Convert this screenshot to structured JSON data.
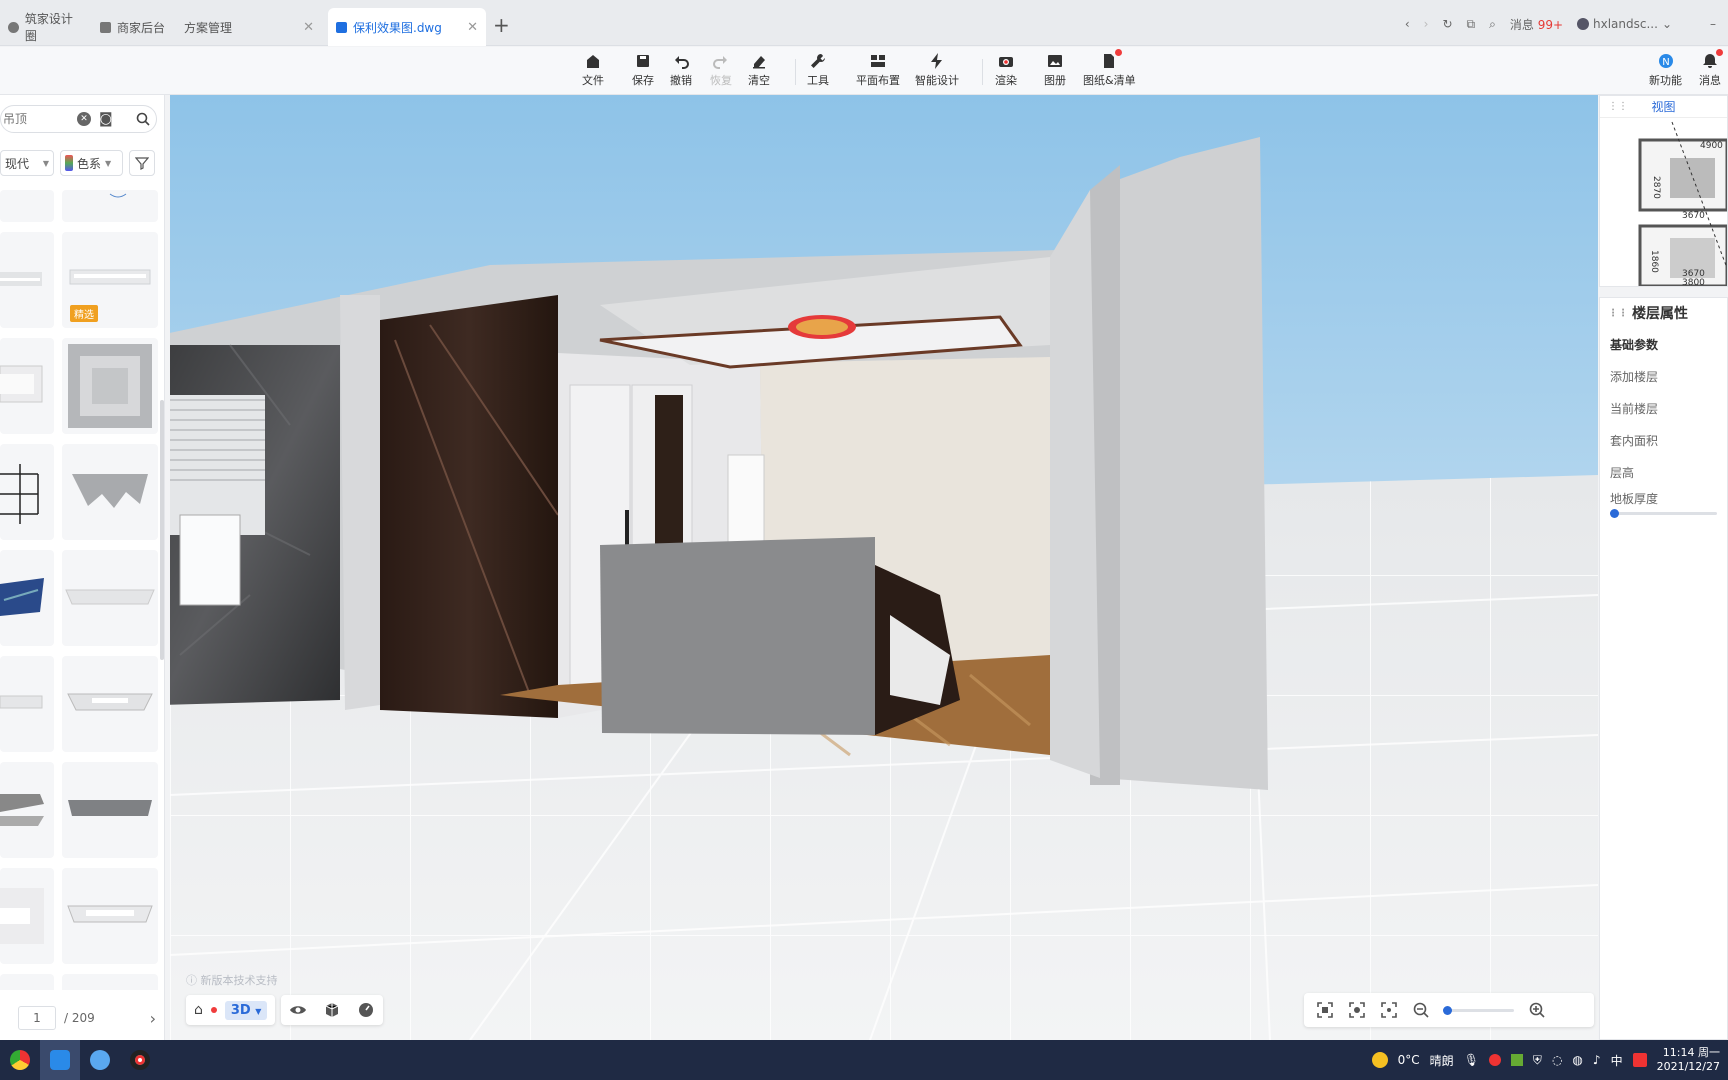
{
  "tabs": [
    {
      "label": "筑家设计圈"
    },
    {
      "label": "商家后台"
    },
    {
      "label": "方案管理"
    },
    {
      "label": "保利效果图.dwg"
    }
  ],
  "nav": {
    "message_label": "消息",
    "message_count": "99+",
    "user": "hxlandsc..."
  },
  "toolbar": {
    "file": "文件",
    "save": "保存",
    "undo": "撤销",
    "redo": "恢复",
    "clear": "清空",
    "tools": "工具",
    "floor_layout": "平面布置",
    "smart_design": "智能设计",
    "render": "渲染",
    "album": "图册",
    "drawings": "图纸&清单",
    "new_feature": "新功能",
    "messages": "消息"
  },
  "left": {
    "search_placeholder": "吊顶",
    "style_filter": "现代",
    "color_filter": "色系",
    "featured_badge": "精选",
    "page_current": "1",
    "page_total": "/ 209"
  },
  "viewport": {
    "mode": "3D",
    "watermark": "新版本技术支持"
  },
  "minimap": {
    "title": "视图",
    "dims": [
      "4900",
      "2870",
      "3670",
      "1860",
      "3670",
      "3800"
    ]
  },
  "floor_props": {
    "title": "楼层属性",
    "section": "基础参数",
    "rows": [
      "添加楼层",
      "当前楼层",
      "套内面积",
      "层高",
      "地板厚度"
    ],
    "slab_thickness_level": 0.02
  },
  "zoom": {
    "level": 0.02
  },
  "taskbar": {
    "weather_temp": "0°C",
    "weather_text": "晴朗",
    "time": "11:14 周一",
    "date": "2021/12/27",
    "ime": "中"
  },
  "colors": {
    "accent": "#2a6ad8",
    "alert": "#f03c3c",
    "badge": "#f0a020"
  }
}
